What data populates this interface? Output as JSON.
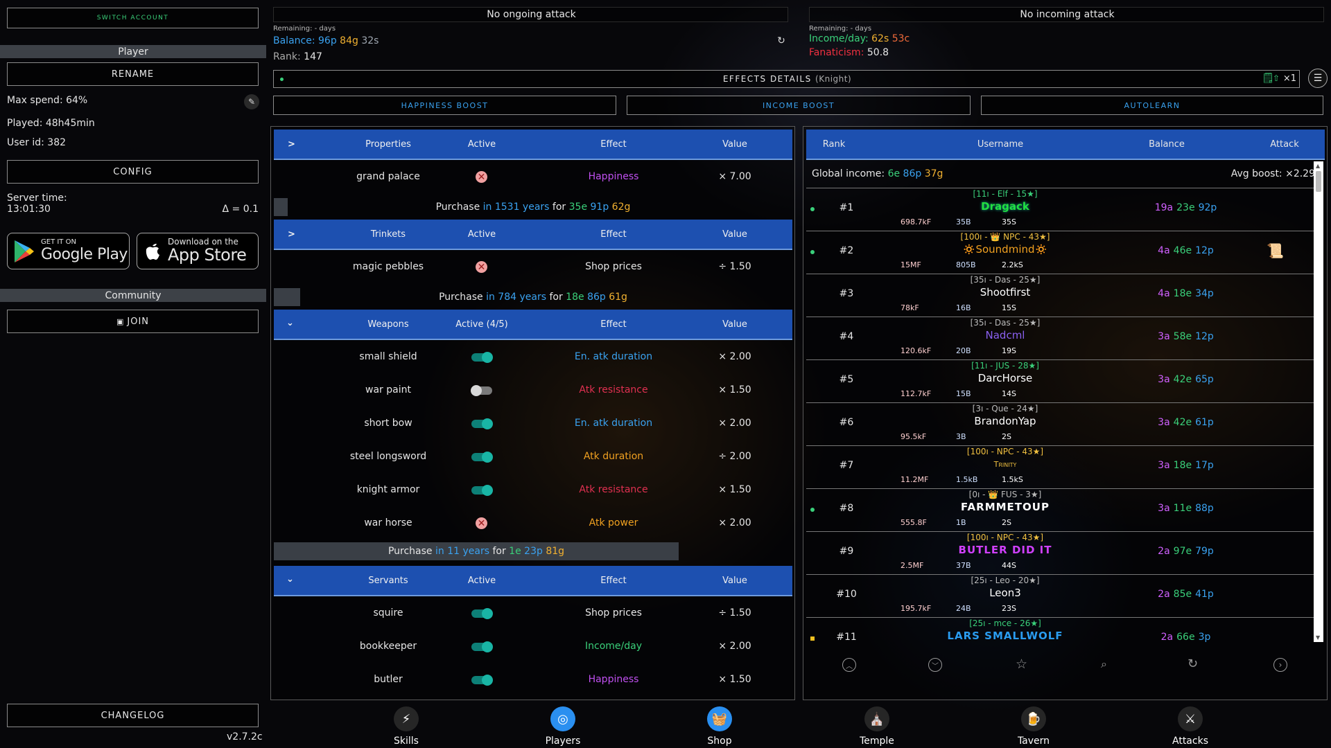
{
  "sidebar": {
    "switch_account": "SWITCH ACCOUNT",
    "player_header": "Player",
    "rename": "RENAME",
    "max_spend": "Max spend: 64%",
    "played": "Played: 48h45min",
    "user_id": "User id: 382",
    "config": "CONFIG",
    "server_time_label": "Server time:",
    "server_time": "13:01:30",
    "delta": "Δ = 0.1",
    "google_small": "GET IT ON",
    "google_big": "Google Play",
    "apple_small": "Download on the",
    "apple_big": "App Store",
    "community_header": "Community",
    "join": "JOIN",
    "changelog": "CHANGELOG",
    "version": "v2.7.2c"
  },
  "attack_out": {
    "title": "No ongoing attack",
    "remaining": "Remaining: - days",
    "balance_label": "Balance:",
    "balance_p": "96p",
    "balance_g": "84g",
    "balance_s": "32s",
    "rank_label": "Rank:",
    "rank_value": "147"
  },
  "attack_in": {
    "title": "No incoming attack",
    "remaining": "Remaining: - days",
    "income_label": "Income/day:",
    "income_s": "62s",
    "income_c": "53c",
    "fanaticism_label": "Fanaticism:",
    "fanaticism_value": "50.8"
  },
  "effects": {
    "label": "EFFECTS DETAILS",
    "class": "(Knight)",
    "multiplier": "×1"
  },
  "boosts": {
    "happiness": "HAPPINESS BOOST",
    "income": "INCOME BOOST",
    "autolearn": "AUTOLEARN"
  },
  "shop": {
    "properties": {
      "header": [
        "Properties",
        "Active",
        "Effect",
        "Value"
      ],
      "items": [
        {
          "name": "grand palace",
          "effect": "Happiness",
          "value": "× 7.00",
          "effect_color": "#c050f0"
        }
      ],
      "purchase": {
        "prefix": "Purchase",
        "when": "in 1531 years",
        "for": "for",
        "e": "35e",
        "p": "91p",
        "g": "62g"
      }
    },
    "trinkets": {
      "header": [
        "Trinkets",
        "Active",
        "Effect",
        "Value"
      ],
      "items": [
        {
          "name": "magic pebbles",
          "effect": "Shop prices",
          "value": "÷ 1.50",
          "effect_color": "#e8e8e8"
        }
      ],
      "purchase": {
        "prefix": "Purchase",
        "when": "in 784 years",
        "for": "for",
        "e": "18e",
        "p": "86p",
        "g": "61g"
      }
    },
    "weapons": {
      "header": [
        "Weapons",
        "Active (4/5)",
        "Effect",
        "Value"
      ],
      "items": [
        {
          "name": "small shield",
          "effect": "En. atk duration",
          "value": "× 2.00",
          "effect_color": "#3aa2f0",
          "state": "on"
        },
        {
          "name": "war paint",
          "effect": "Atk resistance",
          "value": "× 1.50",
          "effect_color": "#e03050",
          "state": "off"
        },
        {
          "name": "short bow",
          "effect": "En. atk duration",
          "value": "× 2.00",
          "effect_color": "#3aa2f0",
          "state": "on"
        },
        {
          "name": "steel longsword",
          "effect": "Atk duration",
          "value": "÷ 2.00",
          "effect_color": "#f0a020",
          "state": "on"
        },
        {
          "name": "knight armor",
          "effect": "Atk resistance",
          "value": "× 1.50",
          "effect_color": "#e03050",
          "state": "on"
        },
        {
          "name": "war horse",
          "effect": "Atk power",
          "value": "× 2.00",
          "effect_color": "#f0a020",
          "state": "x"
        }
      ],
      "purchase": {
        "prefix": "Purchase",
        "when": "in 11 years",
        "for": "for",
        "e": "1e",
        "p": "23p",
        "g": "81g"
      }
    },
    "servants": {
      "header": [
        "Servants",
        "Active",
        "Effect",
        "Value"
      ],
      "items": [
        {
          "name": "squire",
          "effect": "Shop prices",
          "value": "÷ 1.50",
          "effect_color": "#e8e8e8"
        },
        {
          "name": "bookkeeper",
          "effect": "Income/day",
          "value": "× 2.00",
          "effect_color": "#3ad07a"
        },
        {
          "name": "butler",
          "effect": "Happiness",
          "value": "× 1.50",
          "effect_color": "#c050f0"
        }
      ]
    }
  },
  "leaderboard": {
    "header": [
      "Rank",
      "Username",
      "Balance",
      "Attack"
    ],
    "global_income_label": "Global income:",
    "gi_e": "6e",
    "gi_p": "86p",
    "gi_g": "37g",
    "avg_boost": "Avg boost: ×2.29",
    "rows": [
      {
        "rank": "#1",
        "meta": "[11ı - Elf - 15★]",
        "meta_color": "#3ad07a",
        "name": "Dragack",
        "name_color": "#22e040",
        "s1": "698.7kF",
        "s2": "35B",
        "s3": "35S",
        "bal": "19a 23e 92p",
        "dot": "#3ad07a"
      },
      {
        "rank": "#2",
        "meta": "[100ı - 👑 NPC - 43★]",
        "meta_color": "#f0c040",
        "name": "🔅Soundmind🔅",
        "name_color": "#f0a020",
        "s1": "15MF",
        "s2": "805B",
        "s3": "2.2kS",
        "bal": "4a 46e 12p",
        "dot": "#3ad07a",
        "attack_icon": "scroll-icon"
      },
      {
        "rank": "#3",
        "meta": "[35ı - Das - 25★]",
        "meta_color": "#bbbbbb",
        "name": "Shootfirst",
        "name_color": "#ffffff",
        "s1": "78kF",
        "s2": "16B",
        "s3": "15S",
        "bal": "4a 18e 34p"
      },
      {
        "rank": "#4",
        "meta": "[35ı - Das - 25★]",
        "meta_color": "#bbbbbb",
        "name": "Nadcml",
        "name_color": "#8a60f0",
        "s1": "120.6kF",
        "s2": "20B",
        "s3": "19S",
        "bal": "3a 58e 12p"
      },
      {
        "rank": "#5",
        "meta": "[11ı - JUS - 28★]",
        "meta_color": "#3ad07a",
        "name": "DarcHorse",
        "name_color": "#ffffff",
        "s1": "112.7kF",
        "s2": "15B",
        "s3": "14S",
        "bal": "3a 42e 65p"
      },
      {
        "rank": "#6",
        "meta": "[3ı - Que - 24★]",
        "meta_color": "#bbbbbb",
        "name": "BrandonYap",
        "name_color": "#ffffff",
        "s1": "95.5kF",
        "s2": "3B",
        "s3": "2S",
        "bal": "3a 42e 61p"
      },
      {
        "rank": "#7",
        "meta": "[100ı - NPC - 43★]",
        "meta_color": "#f0c040",
        "name": "Trinity",
        "name_color": "#f0c040",
        "s1": "11.2MF",
        "s2": "1.5kB",
        "s3": "1.5kS",
        "bal": "3a 18e 17p"
      },
      {
        "rank": "#8",
        "meta": "[0ı - 👑 FUS - 3★]",
        "meta_color": "#bbbbbb",
        "name": "FARMMETOUP",
        "name_color": "#ffffff",
        "s1": "555.8F",
        "s2": "1B",
        "s3": "2S",
        "bal": "3a 11e 88p",
        "dot": "#3ad07a"
      },
      {
        "rank": "#9",
        "meta": "[100ı - NPC - 43★]",
        "meta_color": "#f0c040",
        "name": "BUTLER DID IT",
        "name_color": "#d040ff",
        "s1": "2.5MF",
        "s2": "37B",
        "s3": "44S",
        "bal": "2a 97e 79p"
      },
      {
        "rank": "#10",
        "meta": "[25ı - Leo - 20★]",
        "meta_color": "#bbbbbb",
        "name": "Leon3",
        "name_color": "#ffffff",
        "s1": "195.7kF",
        "s2": "24B",
        "s3": "23S",
        "bal": "2a 85e 41p"
      },
      {
        "rank": "#11",
        "meta": "[25ı - mce - 26★]",
        "meta_color": "#3ad07a",
        "name": "LARS SMALLWOLF",
        "name_color": "#2a9cf0",
        "s1": "",
        "s2": "",
        "s3": "",
        "bal": "2a 66e 3p",
        "dot": "#f0c020"
      }
    ]
  },
  "bottom_nav": [
    {
      "label": "Skills",
      "icon": "bolt-icon"
    },
    {
      "label": "Players",
      "icon": "target-icon"
    },
    {
      "label": "Shop",
      "icon": "basket-icon"
    },
    {
      "label": "Temple",
      "icon": "temple-icon"
    },
    {
      "label": "Tavern",
      "icon": "mug-icon"
    },
    {
      "label": "Attacks",
      "icon": "sword-icon"
    }
  ]
}
